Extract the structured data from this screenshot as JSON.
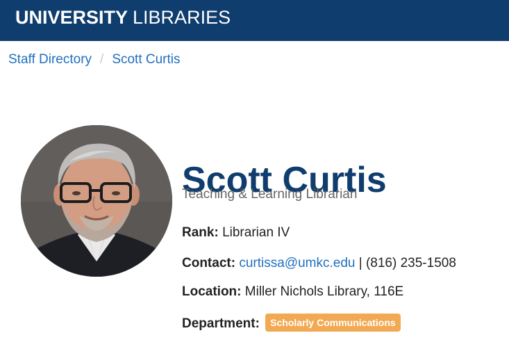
{
  "header": {
    "brand_bold": "UNIVERSITY",
    "brand_light": "LIBRARIES",
    "background_color": "#0f3d6e"
  },
  "breadcrumb": {
    "items": [
      {
        "label": "Staff Directory"
      },
      {
        "label": "Scott Curtis"
      }
    ],
    "separator": "/"
  },
  "profile": {
    "name": "Scott Curtis",
    "job_title": "Teaching & Learning Librarian",
    "rank_label": "Rank:",
    "rank_value": "Librarian IV",
    "contact_label": "Contact:",
    "email": "curtissa@umkc.edu",
    "contact_separator": "|",
    "phone": "(816) 235-1508",
    "location_label": "Location:",
    "location_value": "Miller Nichols Library, 116E",
    "department_label": "Department:",
    "department_badge": "Scholarly Communications",
    "photo_icon": "profile-photo",
    "accent_color": "#0f3d6e",
    "link_color": "#1f6fbf",
    "badge_color": "#f2a953"
  }
}
